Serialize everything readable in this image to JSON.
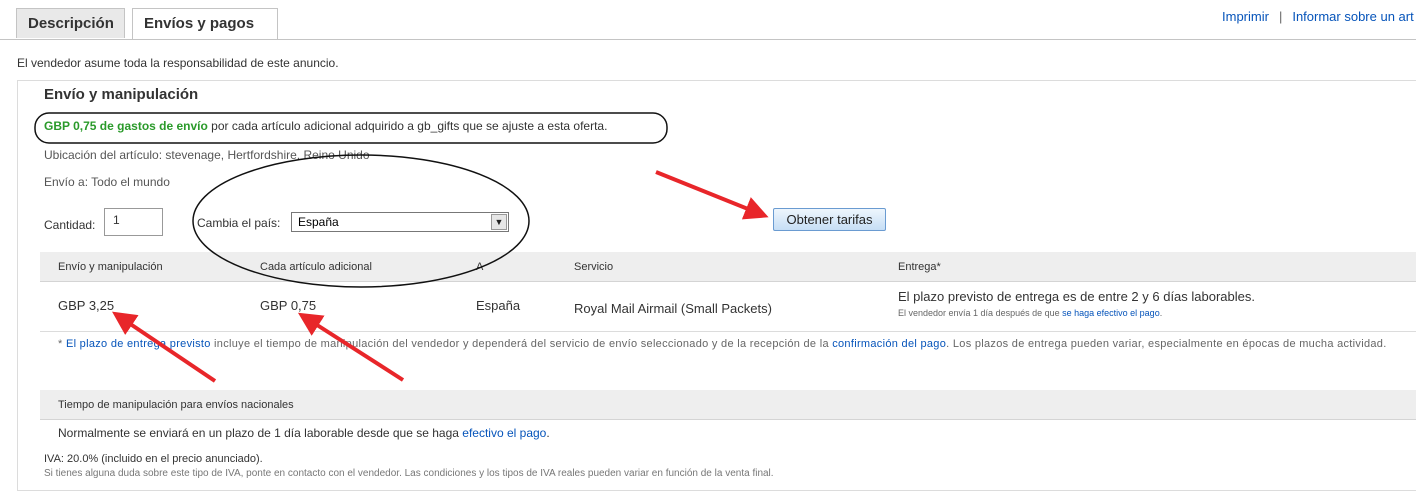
{
  "tabs": {
    "description": "Descripción",
    "shipping": "Envíos y pagos"
  },
  "top_links": {
    "print": "Imprimir",
    "report": "Informar sobre un art"
  },
  "intro": "El vendedor asume toda la responsabilidad de este anuncio.",
  "section_title": "Envío y manipulación",
  "offer": {
    "bold": "GBP 0,75 de gastos de envío",
    "rest": " por cada artículo adicional adquirido a gb_gifts que se ajuste a esta oferta."
  },
  "location": "Ubicación del artículo: stevenage, Hertfordshire, Reino Unido",
  "ships_to": "Envío a: Todo el mundo",
  "quantity": {
    "label": "Cantidad:",
    "value": "1"
  },
  "country": {
    "label": "Cambia el país:",
    "selected": "España"
  },
  "get_rates_button": "Obtener tarifas",
  "table": {
    "headers": [
      "Envío y manipulación",
      "Cada artículo adicional",
      "A",
      "Servicio",
      "Entrega*"
    ],
    "row": {
      "shipping": "GBP 3,25",
      "additional": "GBP 0,75",
      "to": "España",
      "service": "Royal Mail Airmail (Small Packets)",
      "delivery": "El plazo previsto de entrega es de entre 2 y 6 días laborables.",
      "delivery_note_pre": "El vendedor envía 1 día después de que ",
      "delivery_note_link": "se haga efectivo el pago",
      "delivery_note_post": "."
    }
  },
  "footnote": {
    "star": "* ",
    "link1": "El plazo de entrega previsto",
    "text1": " incluye el tiempo de manipulación del vendedor y dependerá del servicio de envío seleccionado y de la recepción de la ",
    "link2": "confirmación del pago",
    "text2": ". Los plazos de entrega pueden variar, especialmente en épocas de mucha actividad."
  },
  "handling_header": "Tiempo de manipulación para envíos nacionales",
  "handling": {
    "text": "Normalmente se enviará en un plazo de 1 día laborable desde que se haga ",
    "link": "efectivo el pago",
    "end": "."
  },
  "vat": "IVA: 20.0% (incluido en el precio anunciado).",
  "vat_note": "Si tienes alguna duda sobre este tipo de IVA, ponte en contacto con el vendedor. Las condiciones y los tipos de IVA reales pueden variar en función de la venta final.",
  "colors": {
    "offer_green": "#2a9a2a",
    "link_blue": "#0654ba",
    "annotation_red": "#e8262a"
  }
}
